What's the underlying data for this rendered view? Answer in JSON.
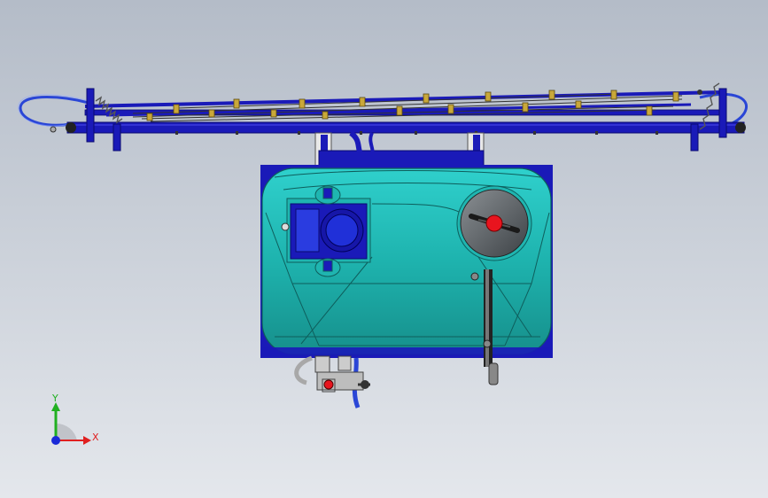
{
  "viewport": {
    "background_top": "#b4bcc8",
    "background_bottom": "#e4e7ec"
  },
  "model": {
    "frame_color": "#1a1ab8",
    "tank_color": "#1fb5b0",
    "tank_edge_color": "#0e5e5c",
    "hose_color": "#2a46d6",
    "reel_marker_color": "#e8141e",
    "bracket_color": "#c9a83a"
  },
  "triad": {
    "x_label": "X",
    "y_label": "Y",
    "x_color": "#e02020",
    "y_color": "#20b020",
    "origin_color": "#1a2ad8"
  }
}
